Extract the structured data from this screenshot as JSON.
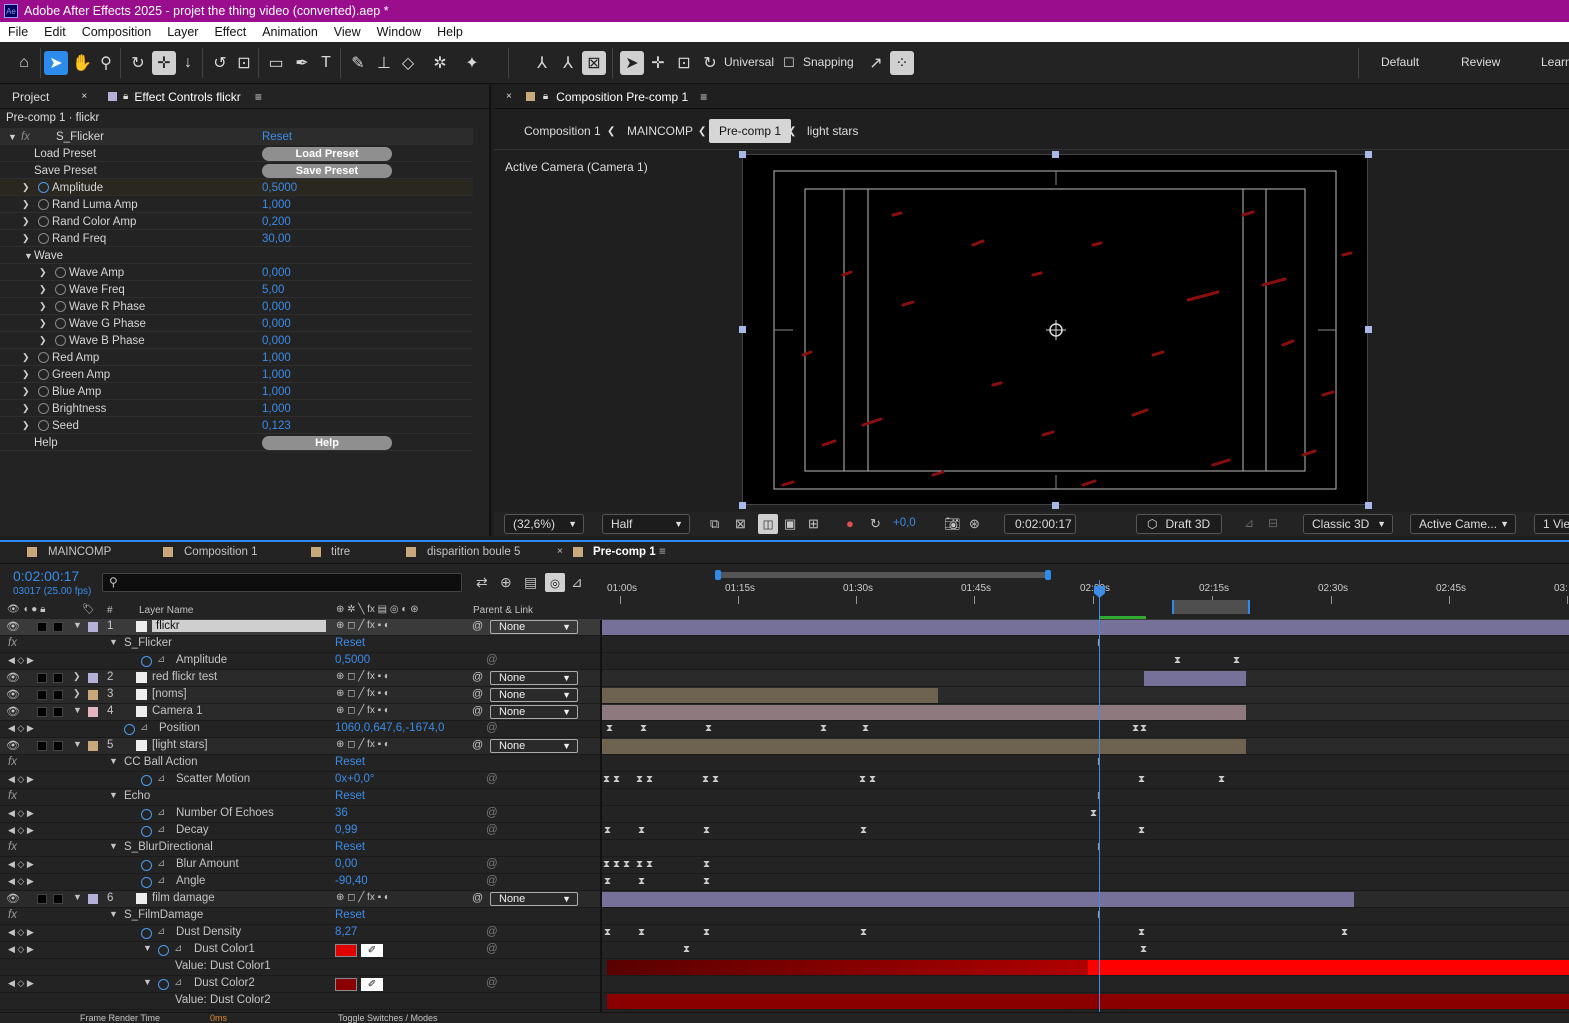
{
  "window": {
    "title": "Adobe After Effects 2025 - projet the thing video (converted).aep *",
    "app_badge": "Ae"
  },
  "menu": [
    "File",
    "Edit",
    "Composition",
    "Layer",
    "Effect",
    "Animation",
    "View",
    "Window",
    "Help"
  ],
  "toolbar": {
    "universal_label": "Universal",
    "snapping_label": "Snapping",
    "workspaces": [
      "Default",
      "Review",
      "Learn"
    ]
  },
  "effect_controls": {
    "tabs": {
      "project": "Project",
      "effect_controls": "Effect Controls flickr"
    },
    "layer_path": "Pre-comp 1 · flickr",
    "effect_name": "S_Flicker",
    "effect_reset": "Reset",
    "load_preset_label": "Load Preset",
    "load_preset_btn": "Load Preset",
    "save_preset_label": "Save Preset",
    "save_preset_btn": "Save Preset",
    "params": [
      {
        "name": "Amplitude",
        "value": "0,5000",
        "level": 0,
        "stopwatch_active": true
      },
      {
        "name": "Rand Luma Amp",
        "value": "1,000",
        "level": 0
      },
      {
        "name": "Rand Color Amp",
        "value": "0,200",
        "level": 0
      },
      {
        "name": "Rand Freq",
        "value": "30,00",
        "level": 0
      }
    ],
    "wave_group": "Wave",
    "wave_params": [
      {
        "name": "Wave Amp",
        "value": "0,000"
      },
      {
        "name": "Wave Freq",
        "value": "5,00"
      },
      {
        "name": "Wave R Phase",
        "value": "0,000"
      },
      {
        "name": "Wave G Phase",
        "value": "0,000"
      },
      {
        "name": "Wave B Phase",
        "value": "0,000"
      }
    ],
    "params2": [
      {
        "name": "Red Amp",
        "value": "1,000"
      },
      {
        "name": "Green Amp",
        "value": "1,000"
      },
      {
        "name": "Blue Amp",
        "value": "1,000"
      },
      {
        "name": "Brightness",
        "value": "1,000"
      },
      {
        "name": "Seed",
        "value": "0,123"
      }
    ],
    "help_label": "Help",
    "help_btn": "Help"
  },
  "composition": {
    "tab": "Composition Pre-comp 1",
    "breadcrumbs": [
      "Composition 1",
      "MAINCOMP",
      "Pre-comp 1",
      "light stars"
    ],
    "camera_label": "Active Camera (Camera 1)",
    "controls": {
      "zoom": "(32,6%)",
      "resolution": "Half",
      "exposure": "+0,0",
      "timecode": "0:02:00:17",
      "renderer_btn": "Draft 3D",
      "renderer": "Classic 3D",
      "view": "Active Came...",
      "views": "1 Vie"
    }
  },
  "timeline": {
    "tabs": [
      "MAINCOMP",
      "Composition 1",
      "titre",
      "disparition boule 5",
      "Pre-comp 1"
    ],
    "timecode": "0:02:00:17",
    "frame_info": "03017 (25.00 fps)",
    "headers": {
      "layer_name": "Layer Name",
      "parent": "Parent & Link",
      "hash": "#"
    },
    "ruler": [
      "01:00s",
      "01:15s",
      "01:30s",
      "01:45s",
      "02:00s",
      "02:15s",
      "02:30s",
      "02:45s",
      "03:"
    ],
    "rows": [
      {
        "type": "layer",
        "num": "1",
        "name": "flickr",
        "parent": "None",
        "label_color": "#b3b0d9",
        "selected": true
      },
      {
        "type": "effect",
        "name": "S_Flicker",
        "value": "Reset"
      },
      {
        "type": "prop",
        "name": "Amplitude",
        "value": "0,5000"
      },
      {
        "type": "layer",
        "num": "2",
        "name": "red flickr test",
        "parent": "None",
        "label_color": "#b3b0d9"
      },
      {
        "type": "layer",
        "num": "3",
        "name": "[noms]",
        "parent": "None",
        "label_color": "#c9a97c"
      },
      {
        "type": "layer",
        "num": "4",
        "name": "Camera 1",
        "parent": "None",
        "label_color": "#e3b6bf"
      },
      {
        "type": "prop",
        "name": "Position",
        "value": "1060,0,647,6,-1674,0"
      },
      {
        "type": "layer",
        "num": "5",
        "name": "[light stars]",
        "parent": "None",
        "label_color": "#c9a97c"
      },
      {
        "type": "effect",
        "name": "CC Ball Action",
        "value": "Reset"
      },
      {
        "type": "prop",
        "name": "Scatter Motion",
        "value": "0x+0,0°"
      },
      {
        "type": "effect",
        "name": "Echo",
        "value": "Reset"
      },
      {
        "type": "prop",
        "name": "Number Of Echoes",
        "value": "36"
      },
      {
        "type": "prop",
        "name": "Decay",
        "value": "0,99"
      },
      {
        "type": "effect",
        "name": "S_BlurDirectional",
        "value": "Reset"
      },
      {
        "type": "prop",
        "name": "Blur Amount",
        "value": "0,00"
      },
      {
        "type": "prop",
        "name": "Angle",
        "value": "-90,40"
      },
      {
        "type": "layer",
        "num": "6",
        "name": "film damage",
        "parent": "None",
        "label_color": "#b3b0d9"
      },
      {
        "type": "effect",
        "name": "S_FilmDamage",
        "value": "Reset"
      },
      {
        "type": "prop",
        "name": "Dust Density",
        "value": "8,27"
      },
      {
        "type": "color",
        "name": "Dust Color1",
        "swatch": "#e00000"
      },
      {
        "type": "valuebar",
        "name": "Value: Dust Color1"
      },
      {
        "type": "color",
        "name": "Dust Color2",
        "swatch": "#8a0000"
      },
      {
        "type": "valuebar",
        "name": "Value: Dust Color2"
      }
    ],
    "footer": {
      "frame_render": "Frame Render Time",
      "render_ms": "0ms",
      "toggle": "Toggle Switches / Modes"
    }
  },
  "colors": {
    "accent": "#2d8ceb",
    "title_bar": "#9a0e8d",
    "value_blue": "#3c8ce8"
  }
}
